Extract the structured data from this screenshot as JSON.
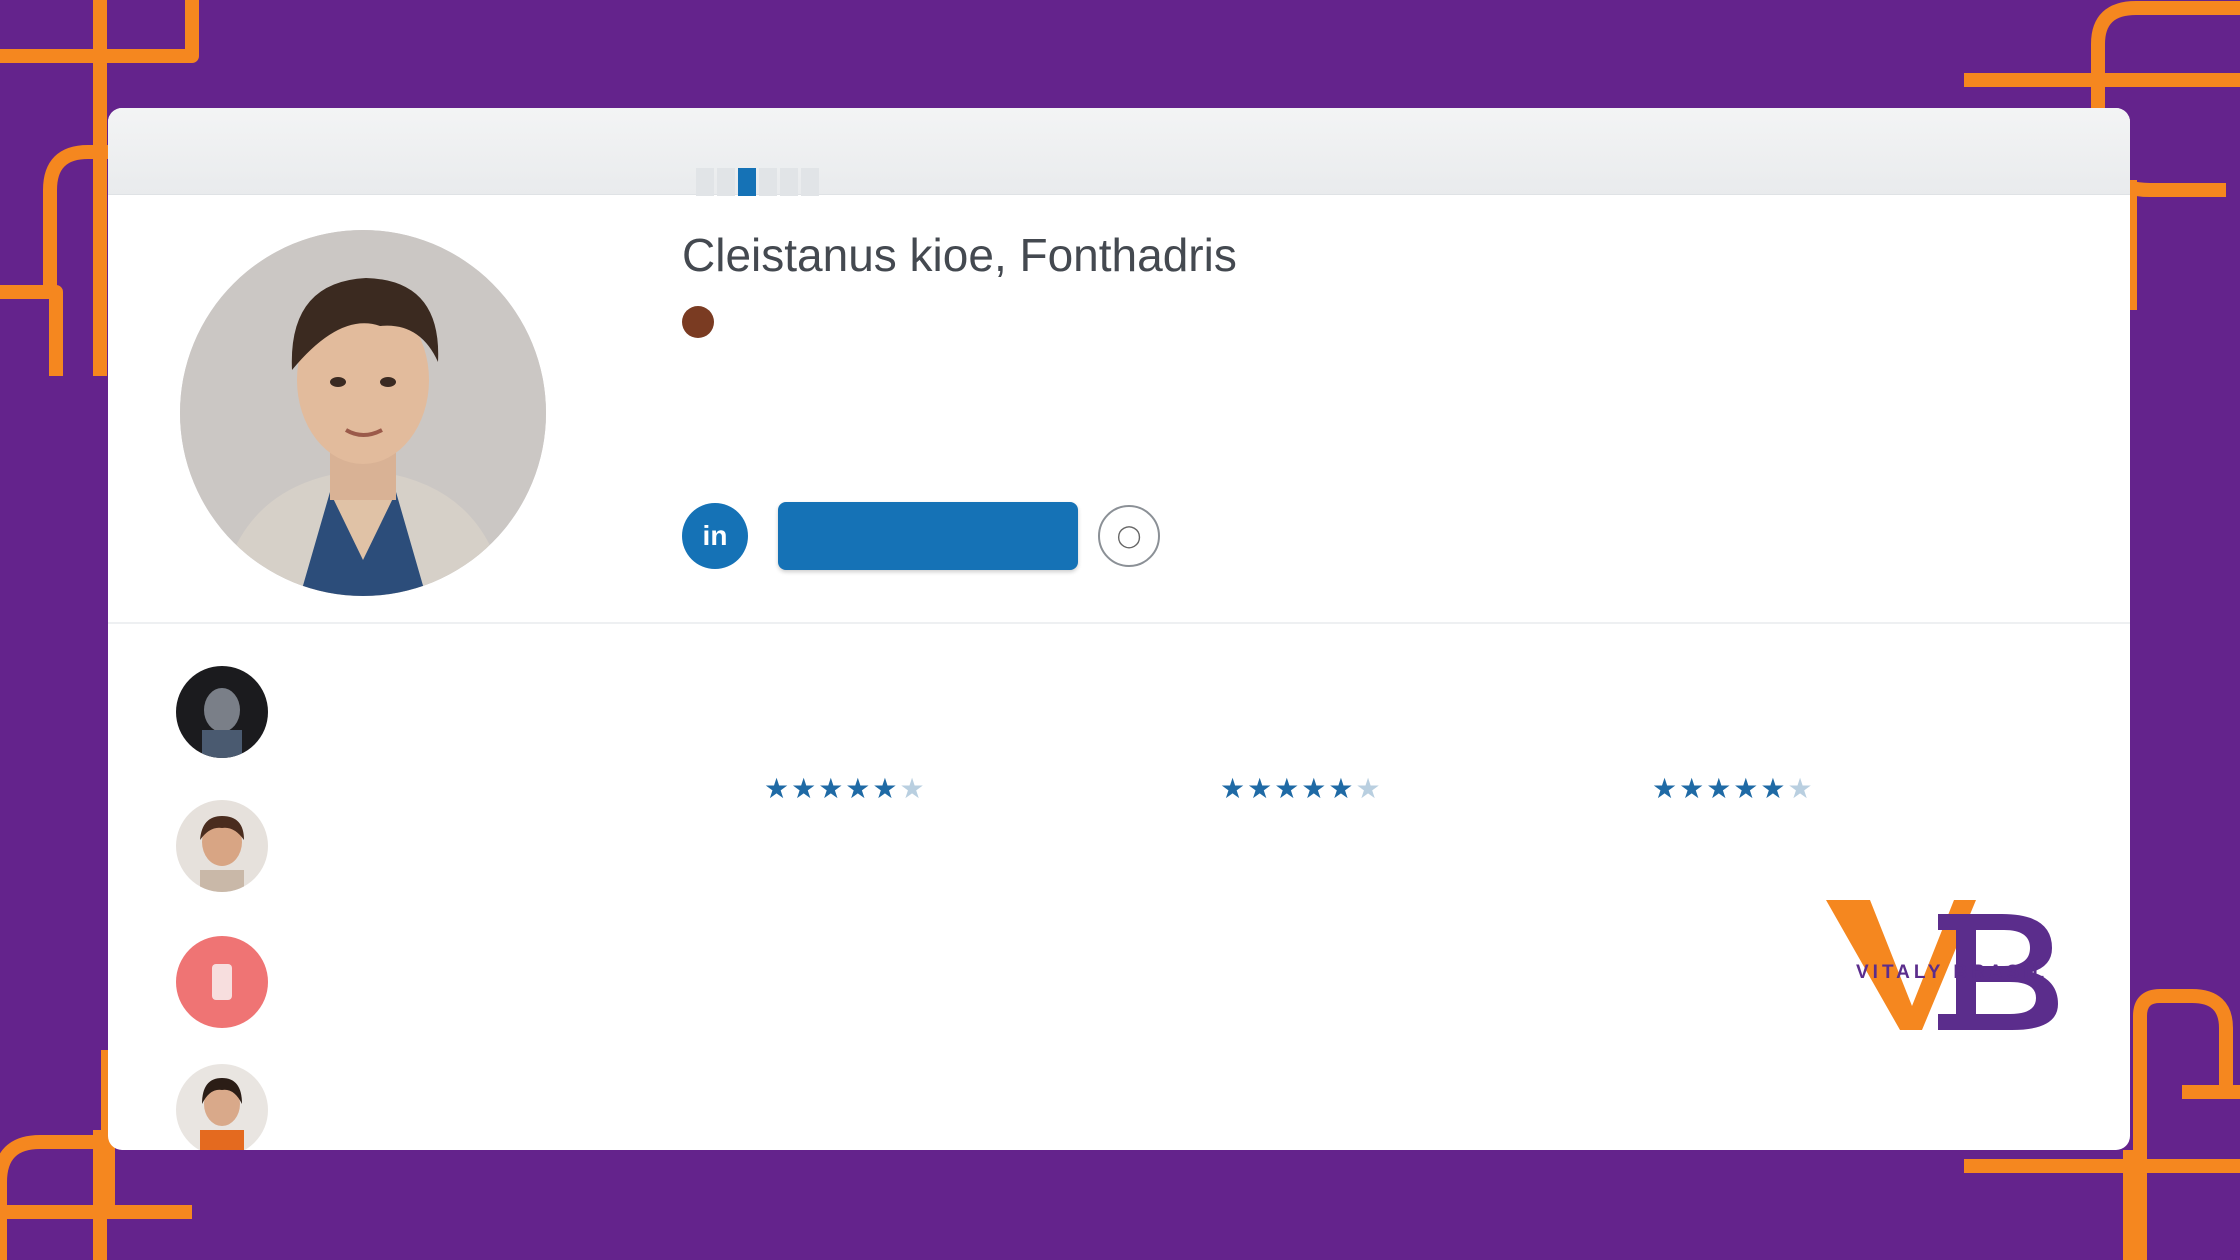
{
  "colors": {
    "background": "#64238c",
    "accent": "#f5871f",
    "primary": "#1572b6",
    "card": "#ffffff"
  },
  "topbar": {
    "crumb": "",
    "crumb_sub": "",
    "tabs": [
      {
        "label": "",
        "active": false
      },
      {
        "label": "",
        "active": false
      },
      {
        "label": "",
        "active": true
      },
      {
        "label": "",
        "active": false
      },
      {
        "label": "",
        "active": false
      },
      {
        "label": "",
        "active": false
      }
    ]
  },
  "profile": {
    "name": "Cleistanus kioe, Fonthadris",
    "meta_text": "",
    "meta_link": "",
    "bio": "",
    "primary_button": "",
    "round_button_icon": "linkedin-icon",
    "ghost_button_icon": "chat-icon"
  },
  "people": [
    {
      "name": "",
      "role": ""
    },
    {
      "name": "",
      "role": ""
    },
    {
      "name": "",
      "role": ""
    },
    {
      "name": "",
      "role": ""
    }
  ],
  "columns": [
    {
      "head": "",
      "rating": 4.5,
      "line1": "",
      "line2": ""
    },
    {
      "head": "",
      "rating": 4.5,
      "line1": "",
      "line2": ""
    },
    {
      "head": "",
      "rating": 4.5,
      "line1": "",
      "line2": ""
    }
  ],
  "logo": {
    "text": "VITALY BRASIL",
    "mark": "VB"
  }
}
